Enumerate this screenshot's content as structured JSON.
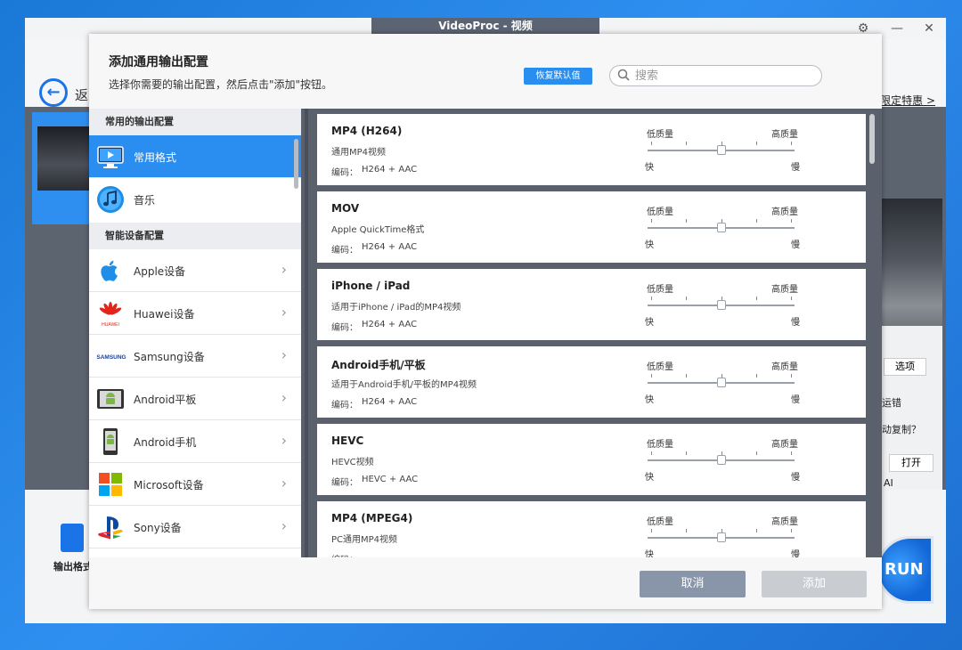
{
  "app": {
    "window_title": "VideoProc - 视频",
    "back_label": "返",
    "promo_link": "限定特惠 >",
    "right_panel": {
      "options_btn": "选项",
      "text1": "运错",
      "text2": "动复制？",
      "open_btn": "打开",
      "text3": "AI"
    },
    "output_label": "输出格式",
    "run_label": "RUN"
  },
  "dialog": {
    "title": "添加通用输出配置",
    "subtitle": "选择你需要的输出配置，然后点击\"添加\"按钮。",
    "restore_label": "恢复默认值",
    "search_placeholder": "搜索",
    "cancel_label": "取消",
    "add_label": "添加"
  },
  "sidebar": {
    "common_header": "常用的输出配置",
    "device_header": "智能设备配置",
    "common_items": [
      {
        "label": "常用格式",
        "icon": "monitor-icon"
      },
      {
        "label": "音乐",
        "icon": "music-icon"
      }
    ],
    "device_items": [
      {
        "label": "Apple设备",
        "icon": "apple-icon"
      },
      {
        "label": "Huawei设备",
        "icon": "huawei-icon",
        "logo_text": "HUAWEI"
      },
      {
        "label": "Samsung设备",
        "icon": "samsung-icon",
        "logo_text": "SAMSUNG"
      },
      {
        "label": "Android平板",
        "icon": "android-tablet-icon"
      },
      {
        "label": "Android手机",
        "icon": "android-phone-icon"
      },
      {
        "label": "Microsoft设备",
        "icon": "microsoft-icon"
      },
      {
        "label": "Sony设备",
        "icon": "playstation-icon"
      }
    ]
  },
  "quality": {
    "low": "低质量",
    "high": "高质量",
    "fast": "快",
    "slow": "慢",
    "codec_label": "编码："
  },
  "formats": [
    {
      "name": "MP4 (H264)",
      "desc": "通用MP4视频",
      "codec": "H264 + AAC",
      "level": 0.5
    },
    {
      "name": "MOV",
      "desc": "Apple QuickTime格式",
      "codec": "H264 + AAC",
      "level": 0.5
    },
    {
      "name": "iPhone / iPad",
      "desc": "适用于iPhone / iPad的MP4视频",
      "codec": "H264 + AAC",
      "level": 0.5
    },
    {
      "name": "Android手机/平板",
      "desc": "适用于Android手机/平板的MP4视频",
      "codec": "H264 + AAC",
      "level": 0.5
    },
    {
      "name": "HEVC",
      "desc": "HEVC视频",
      "codec": "HEVC + AAC",
      "level": 0.5
    },
    {
      "name": "MP4 (MPEG4)",
      "desc": "PC通用MP4视频",
      "codec": "",
      "level": 0.5
    }
  ],
  "colors": {
    "accent": "#2a8ef0",
    "cancel": "#8996aa",
    "add_disabled": "#c9ccd1"
  }
}
